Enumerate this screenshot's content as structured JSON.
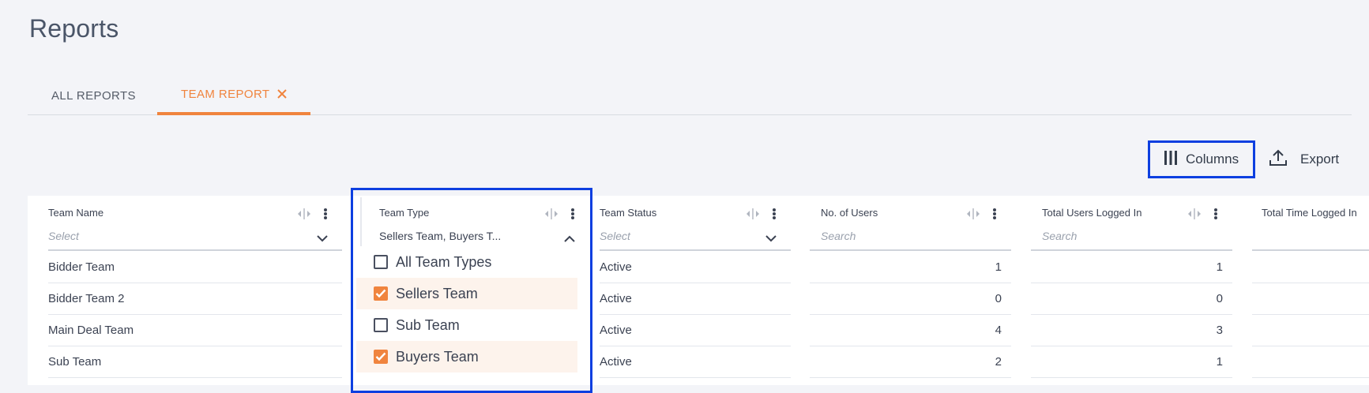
{
  "page": {
    "title": "Reports"
  },
  "tabs": [
    {
      "label": "ALL REPORTS",
      "active": false
    },
    {
      "label": "TEAM REPORT",
      "active": true
    }
  ],
  "toolbar": {
    "columns_label": "Columns",
    "export_label": "Export"
  },
  "colors": {
    "accent": "#f0843e",
    "highlight_frame": "#0d3fe0"
  },
  "columns": [
    {
      "header": "Team Name",
      "filter": "Select"
    },
    {
      "header": "Team Type",
      "filter": "Sellers Team, Buyers T..."
    },
    {
      "header": "Team Status",
      "filter": "Select"
    },
    {
      "header": "No. of Users",
      "filter": "Search"
    },
    {
      "header": "Total Users Logged In",
      "filter": "Search"
    },
    {
      "header": "Total Time Logged In"
    }
  ],
  "rows": [
    {
      "team_name": "Bidder Team",
      "status": "Active",
      "users": "1",
      "logged_in": "1"
    },
    {
      "team_name": "Bidder Team 2",
      "status": "Active",
      "users": "0",
      "logged_in": "0"
    },
    {
      "team_name": "Main Deal Team",
      "status": "Active",
      "users": "4",
      "logged_in": "3"
    },
    {
      "team_name": "Sub Team",
      "status": "Active",
      "users": "2",
      "logged_in": "1"
    }
  ],
  "team_type_dropdown": {
    "options": [
      {
        "label": "All Team Types",
        "checked": false
      },
      {
        "label": "Sellers Team",
        "checked": true
      },
      {
        "label": "Sub Team",
        "checked": false
      },
      {
        "label": "Buyers Team",
        "checked": true
      }
    ]
  }
}
